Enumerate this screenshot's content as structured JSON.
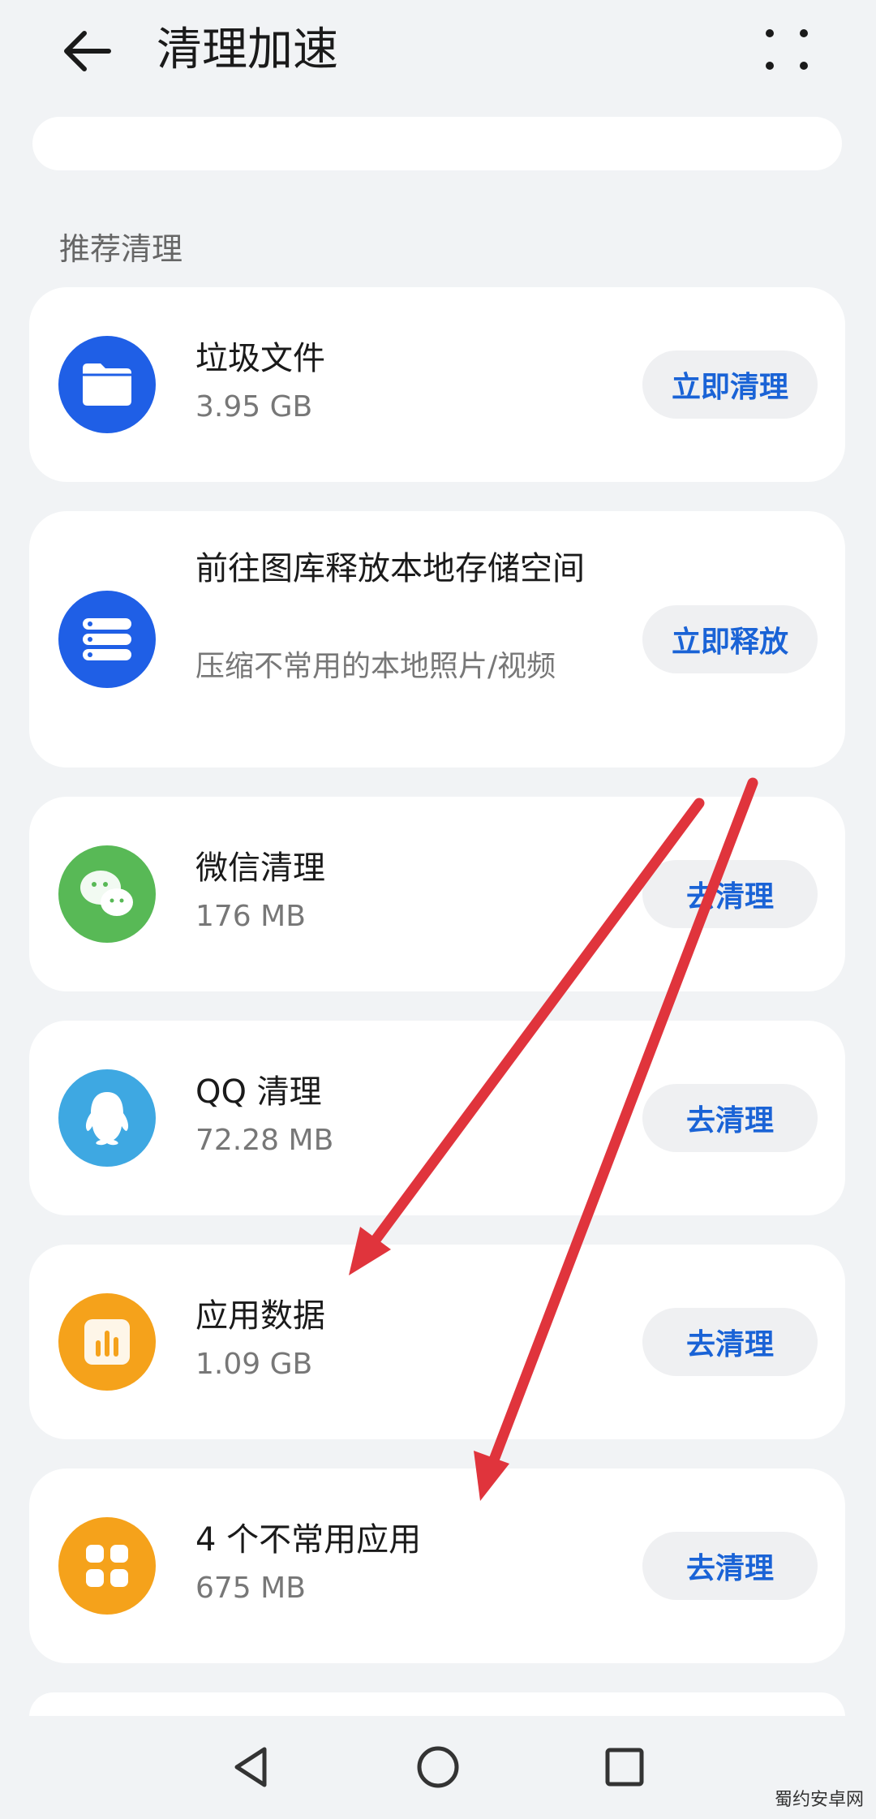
{
  "header": {
    "title": "清理加速"
  },
  "section_label": "推荐清理",
  "items": [
    {
      "title": "垃圾文件",
      "subtitle": "3.95 GB",
      "button": "立即清理",
      "icon": "folder-icon",
      "color": "#1f5fe6"
    },
    {
      "title": "前往图库释放本地存储空间",
      "subtitle": "压缩不常用的本地照片/视频",
      "button": "立即释放",
      "icon": "storage-icon",
      "color": "#1f5fe6"
    },
    {
      "title": "微信清理",
      "subtitle": "176 MB",
      "button": "去清理",
      "icon": "wechat-icon",
      "color": "#58b956"
    },
    {
      "title": "QQ 清理",
      "subtitle": "72.28 MB",
      "button": "去清理",
      "icon": "qq-icon",
      "color": "#3ea8e2"
    },
    {
      "title": "应用数据",
      "subtitle": "1.09 GB",
      "button": "去清理",
      "icon": "app-data-icon",
      "color": "#f5a21b"
    },
    {
      "title": "4 个不常用应用",
      "subtitle": "675 MB",
      "button": "去清理",
      "icon": "apps-grid-icon",
      "color": "#f5a21b"
    }
  ],
  "colors": {
    "accent": "#1a63d6",
    "annotation_arrow": "#e0343c",
    "background": "#f1f3f5"
  },
  "watermark": "蜀约安卓网"
}
